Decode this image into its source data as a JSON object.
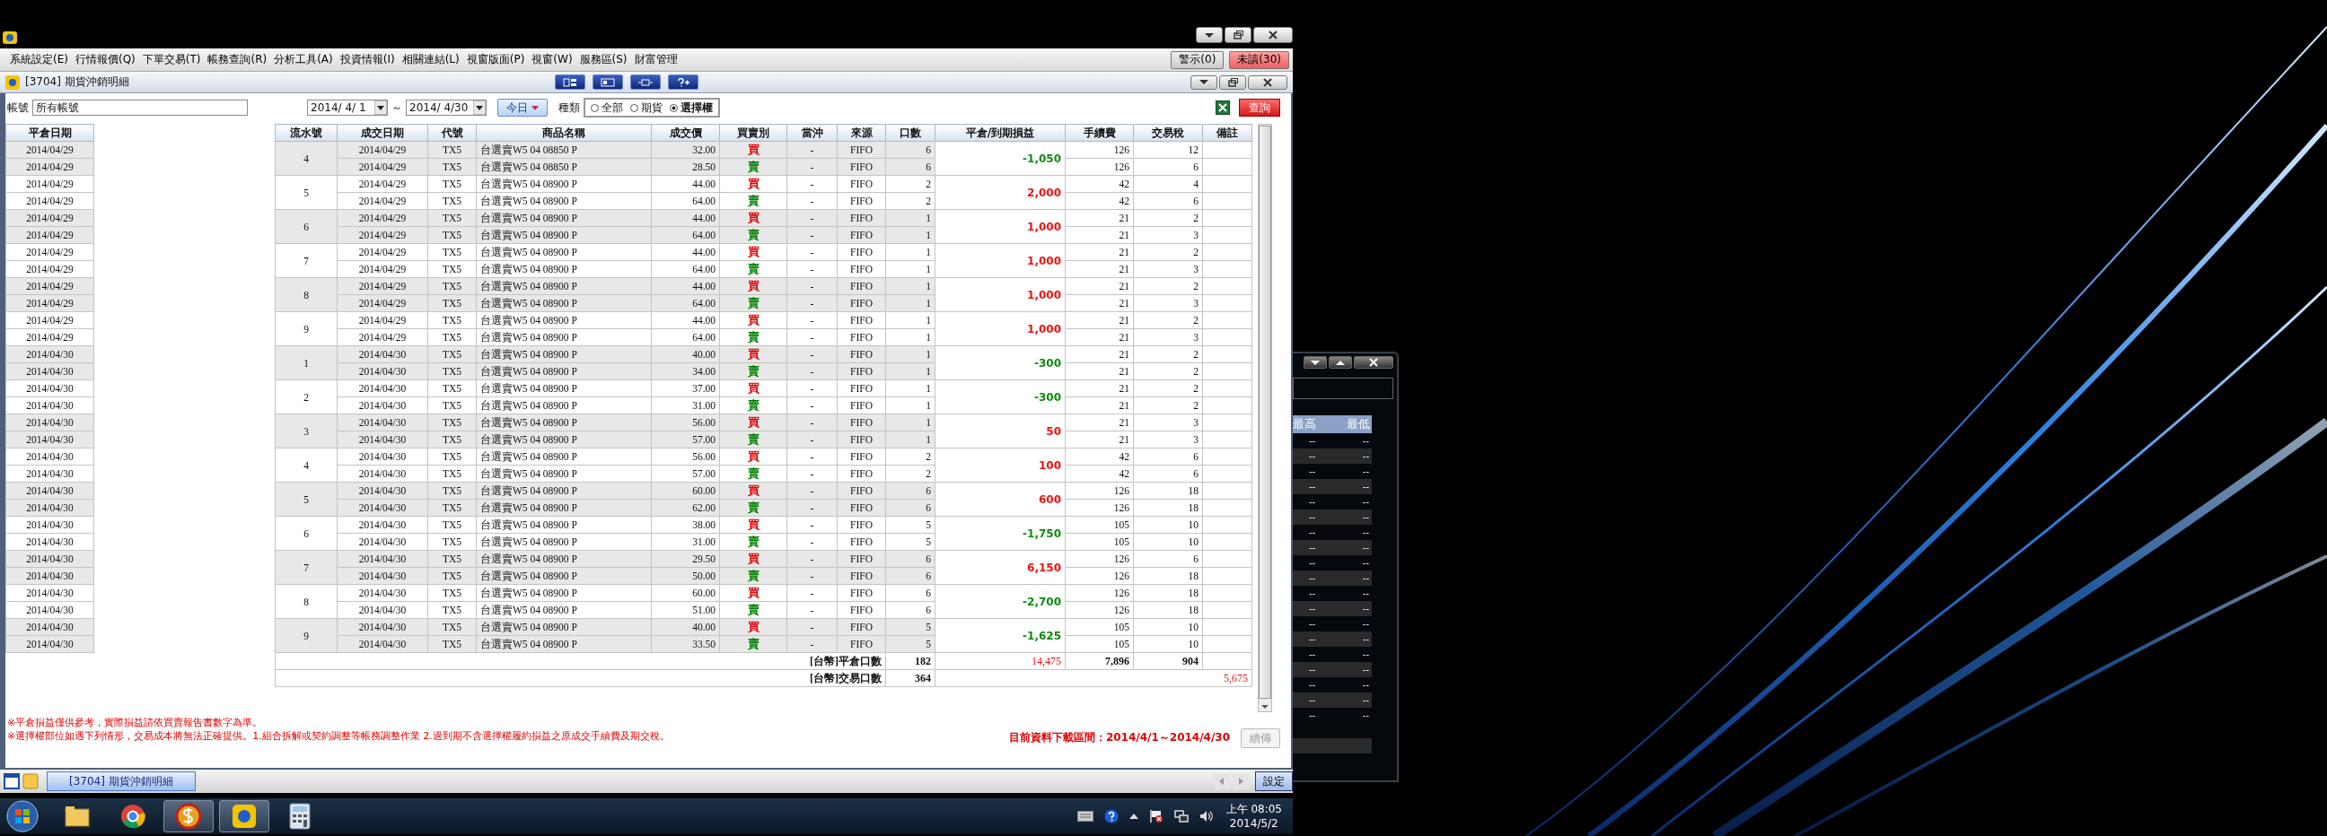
{
  "menu_bar": {
    "items": [
      "系統設定(E)",
      "行情報價(Q)",
      "下單交易(T)",
      "帳務查詢(R)",
      "分析工具(A)",
      "投資情報(I)",
      "相關連結(L)",
      "視窗版面(P)",
      "視窗(W)",
      "服務區(S)",
      "財富管理"
    ],
    "alert_button": "警示(0)",
    "unread_button": "未讀(30)"
  },
  "window": {
    "title": "[3704] 期貨沖銷明細"
  },
  "filters": {
    "account_label": "帳號",
    "account": "所有帳號",
    "date_from": "2014/ 4/ 1",
    "separator": "～",
    "date_to": "2014/ 4/30",
    "today_button": "今日",
    "type_label": "種類",
    "types": [
      {
        "label": "全部",
        "selected": false
      },
      {
        "label": "期貨",
        "selected": false
      },
      {
        "label": "選擇權",
        "selected": true
      }
    ],
    "query_button": "查詢"
  },
  "close_date_table": {
    "column": "平倉日期",
    "rows": [
      "2014/04/29",
      "2014/04/29",
      "2014/04/29",
      "2014/04/29",
      "2014/04/29",
      "2014/04/29",
      "2014/04/29",
      "2014/04/29",
      "2014/04/29",
      "2014/04/29",
      "2014/04/29",
      "2014/04/29",
      "2014/04/30",
      "2014/04/30",
      "2014/04/30",
      "2014/04/30",
      "2014/04/30",
      "2014/04/30",
      "2014/04/30",
      "2014/04/30",
      "2014/04/30",
      "2014/04/30",
      "2014/04/30",
      "2014/04/30",
      "2014/04/30",
      "2014/04/30",
      "2014/04/30",
      "2014/04/30",
      "2014/04/30",
      "2014/04/30"
    ]
  },
  "detail_table": {
    "columns": [
      "流水號",
      "成交日期",
      "代號",
      "商品名稱",
      "成交價",
      "買賣別",
      "當沖",
      "來源",
      "口數",
      "平倉/到期損益",
      "手續費",
      "交易稅",
      "備註"
    ],
    "groups": [
      {
        "serial": "4",
        "pnl": "-1,050",
        "color": "#108a10",
        "legs": [
          {
            "date": "2014/04/29",
            "code": "TX5",
            "product": "台選賣W5 04 08850 P",
            "price": "32.00",
            "side": "買",
            "color": "#e00000",
            "daytrade": "-",
            "source": "FIFO",
            "qty": "6",
            "fee": "126",
            "tax": "12"
          },
          {
            "date": "2014/04/29",
            "code": "TX5",
            "product": "台選賣W5 04 08850 P",
            "price": "28.50",
            "side": "賣",
            "color": "#008000",
            "daytrade": "-",
            "source": "FIFO",
            "qty": "6",
            "fee": "126",
            "tax": "6"
          }
        ]
      },
      {
        "serial": "5",
        "pnl": "2,000",
        "color": "#f01010",
        "legs": [
          {
            "date": "2014/04/29",
            "code": "TX5",
            "product": "台選賣W5 04 08900 P",
            "price": "44.00",
            "side": "買",
            "color": "#e00000",
            "daytrade": "-",
            "source": "FIFO",
            "qty": "2",
            "fee": "42",
            "tax": "4"
          },
          {
            "date": "2014/04/29",
            "code": "TX5",
            "product": "台選賣W5 04 08900 P",
            "price": "64.00",
            "side": "賣",
            "color": "#008000",
            "daytrade": "-",
            "source": "FIFO",
            "qty": "2",
            "fee": "42",
            "tax": "6"
          }
        ]
      },
      {
        "serial": "6",
        "pnl": "1,000",
        "color": "#f01010",
        "legs": [
          {
            "date": "2014/04/29",
            "code": "TX5",
            "product": "台選賣W5 04 08900 P",
            "price": "44.00",
            "side": "買",
            "color": "#e00000",
            "daytrade": "-",
            "source": "FIFO",
            "qty": "1",
            "fee": "21",
            "tax": "2"
          },
          {
            "date": "2014/04/29",
            "code": "TX5",
            "product": "台選賣W5 04 08900 P",
            "price": "64.00",
            "side": "賣",
            "color": "#008000",
            "daytrade": "-",
            "source": "FIFO",
            "qty": "1",
            "fee": "21",
            "tax": "3"
          }
        ]
      },
      {
        "serial": "7",
        "pnl": "1,000",
        "color": "#f01010",
        "legs": [
          {
            "date": "2014/04/29",
            "code": "TX5",
            "product": "台選賣W5 04 08900 P",
            "price": "44.00",
            "side": "買",
            "color": "#e00000",
            "daytrade": "-",
            "source": "FIFO",
            "qty": "1",
            "fee": "21",
            "tax": "2"
          },
          {
            "date": "2014/04/29",
            "code": "TX5",
            "product": "台選賣W5 04 08900 P",
            "price": "64.00",
            "side": "賣",
            "color": "#008000",
            "daytrade": "-",
            "source": "FIFO",
            "qty": "1",
            "fee": "21",
            "tax": "3"
          }
        ]
      },
      {
        "serial": "8",
        "pnl": "1,000",
        "color": "#f01010",
        "legs": [
          {
            "date": "2014/04/29",
            "code": "TX5",
            "product": "台選賣W5 04 08900 P",
            "price": "44.00",
            "side": "買",
            "color": "#e00000",
            "daytrade": "-",
            "source": "FIFO",
            "qty": "1",
            "fee": "21",
            "tax": "2"
          },
          {
            "date": "2014/04/29",
            "code": "TX5",
            "product": "台選賣W5 04 08900 P",
            "price": "64.00",
            "side": "賣",
            "color": "#008000",
            "daytrade": "-",
            "source": "FIFO",
            "qty": "1",
            "fee": "21",
            "tax": "3"
          }
        ]
      },
      {
        "serial": "9",
        "pnl": "1,000",
        "color": "#f01010",
        "legs": [
          {
            "date": "2014/04/29",
            "code": "TX5",
            "product": "台選賣W5 04 08900 P",
            "price": "44.00",
            "side": "買",
            "color": "#e00000",
            "daytrade": "-",
            "source": "FIFO",
            "qty": "1",
            "fee": "21",
            "tax": "2"
          },
          {
            "date": "2014/04/29",
            "code": "TX5",
            "product": "台選賣W5 04 08900 P",
            "price": "64.00",
            "side": "賣",
            "color": "#008000",
            "daytrade": "-",
            "source": "FIFO",
            "qty": "1",
            "fee": "21",
            "tax": "3"
          }
        ]
      },
      {
        "serial": "1",
        "pnl": "-300",
        "color": "#108a10",
        "legs": [
          {
            "date": "2014/04/30",
            "code": "TX5",
            "product": "台選賣W5 04 08900 P",
            "price": "40.00",
            "side": "買",
            "color": "#e00000",
            "daytrade": "-",
            "source": "FIFO",
            "qty": "1",
            "fee": "21",
            "tax": "2"
          },
          {
            "date": "2014/04/30",
            "code": "TX5",
            "product": "台選賣W5 04 08900 P",
            "price": "34.00",
            "side": "賣",
            "color": "#008000",
            "daytrade": "-",
            "source": "FIFO",
            "qty": "1",
            "fee": "21",
            "tax": "2"
          }
        ]
      },
      {
        "serial": "2",
        "pnl": "-300",
        "color": "#108a10",
        "legs": [
          {
            "date": "2014/04/30",
            "code": "TX5",
            "product": "台選賣W5 04 08900 P",
            "price": "37.00",
            "side": "買",
            "color": "#e00000",
            "daytrade": "-",
            "source": "FIFO",
            "qty": "1",
            "fee": "21",
            "tax": "2"
          },
          {
            "date": "2014/04/30",
            "code": "TX5",
            "product": "台選賣W5 04 08900 P",
            "price": "31.00",
            "side": "賣",
            "color": "#008000",
            "daytrade": "-",
            "source": "FIFO",
            "qty": "1",
            "fee": "21",
            "tax": "2"
          }
        ]
      },
      {
        "serial": "3",
        "pnl": "50",
        "color": "#f01010",
        "legs": [
          {
            "date": "2014/04/30",
            "code": "TX5",
            "product": "台選賣W5 04 08900 P",
            "price": "56.00",
            "side": "買",
            "color": "#e00000",
            "daytrade": "-",
            "source": "FIFO",
            "qty": "1",
            "fee": "21",
            "tax": "3"
          },
          {
            "date": "2014/04/30",
            "code": "TX5",
            "product": "台選賣W5 04 08900 P",
            "price": "57.00",
            "side": "賣",
            "color": "#008000",
            "daytrade": "-",
            "source": "FIFO",
            "qty": "1",
            "fee": "21",
            "tax": "3"
          }
        ]
      },
      {
        "serial": "4",
        "pnl": "100",
        "color": "#f01010",
        "legs": [
          {
            "date": "2014/04/30",
            "code": "TX5",
            "product": "台選賣W5 04 08900 P",
            "price": "56.00",
            "side": "買",
            "color": "#e00000",
            "daytrade": "-",
            "source": "FIFO",
            "qty": "2",
            "fee": "42",
            "tax": "6"
          },
          {
            "date": "2014/04/30",
            "code": "TX5",
            "product": "台選賣W5 04 08900 P",
            "price": "57.00",
            "side": "賣",
            "color": "#008000",
            "daytrade": "-",
            "source": "FIFO",
            "qty": "2",
            "fee": "42",
            "tax": "6"
          }
        ]
      },
      {
        "serial": "5",
        "pnl": "600",
        "color": "#f01010",
        "legs": [
          {
            "date": "2014/04/30",
            "code": "TX5",
            "product": "台選賣W5 04 08900 P",
            "price": "60.00",
            "side": "買",
            "color": "#e00000",
            "daytrade": "-",
            "source": "FIFO",
            "qty": "6",
            "fee": "126",
            "tax": "18"
          },
          {
            "date": "2014/04/30",
            "code": "TX5",
            "product": "台選賣W5 04 08900 P",
            "price": "62.00",
            "side": "賣",
            "color": "#008000",
            "daytrade": "-",
            "source": "FIFO",
            "qty": "6",
            "fee": "126",
            "tax": "18"
          }
        ]
      },
      {
        "serial": "6",
        "pnl": "-1,750",
        "color": "#108a10",
        "legs": [
          {
            "date": "2014/04/30",
            "code": "TX5",
            "product": "台選賣W5 04 08900 P",
            "price": "38.00",
            "side": "買",
            "color": "#e00000",
            "daytrade": "-",
            "source": "FIFO",
            "qty": "5",
            "fee": "105",
            "tax": "10"
          },
          {
            "date": "2014/04/30",
            "code": "TX5",
            "product": "台選賣W5 04 08900 P",
            "price": "31.00",
            "side": "賣",
            "color": "#008000",
            "daytrade": "-",
            "source": "FIFO",
            "qty": "5",
            "fee": "105",
            "tax": "10"
          }
        ]
      },
      {
        "serial": "7",
        "pnl": "6,150",
        "color": "#f01010",
        "legs": [
          {
            "date": "2014/04/30",
            "code": "TX5",
            "product": "台選賣W5 04 08900 P",
            "price": "29.50",
            "side": "買",
            "color": "#e00000",
            "daytrade": "-",
            "source": "FIFO",
            "qty": "6",
            "fee": "126",
            "tax": "6"
          },
          {
            "date": "2014/04/30",
            "code": "TX5",
            "product": "台選賣W5 04 08900 P",
            "price": "50.00",
            "side": "賣",
            "color": "#008000",
            "daytrade": "-",
            "source": "FIFO",
            "qty": "6",
            "fee": "126",
            "tax": "18"
          }
        ]
      },
      {
        "serial": "8",
        "pnl": "-2,700",
        "color": "#108a10",
        "legs": [
          {
            "date": "2014/04/30",
            "code": "TX5",
            "product": "台選賣W5 04 08900 P",
            "price": "60.00",
            "side": "買",
            "color": "#e00000",
            "daytrade": "-",
            "source": "FIFO",
            "qty": "6",
            "fee": "126",
            "tax": "18"
          },
          {
            "date": "2014/04/30",
            "code": "TX5",
            "product": "台選賣W5 04 08900 P",
            "price": "51.00",
            "side": "賣",
            "color": "#008000",
            "daytrade": "-",
            "source": "FIFO",
            "qty": "6",
            "fee": "126",
            "tax": "18"
          }
        ]
      },
      {
        "serial": "9",
        "pnl": "-1,625",
        "color": "#108a10",
        "legs": [
          {
            "date": "2014/04/30",
            "code": "TX5",
            "product": "台選賣W5 04 08900 P",
            "price": "40.00",
            "side": "買",
            "color": "#e00000",
            "daytrade": "-",
            "source": "FIFO",
            "qty": "5",
            "fee": "105",
            "tax": "10"
          },
          {
            "date": "2014/04/30",
            "code": "TX5",
            "product": "台選賣W5 04 08900 P",
            "price": "33.50",
            "side": "賣",
            "color": "#008000",
            "daytrade": "-",
            "source": "FIFO",
            "qty": "5",
            "fee": "105",
            "tax": "10"
          }
        ]
      }
    ],
    "totals": {
      "closed": {
        "label": "[台幣]平倉口數",
        "qty": "182",
        "pnl": "14,475",
        "fee": "7,896",
        "tax": "904"
      },
      "traded": {
        "label": "[台幣]交易口數",
        "qty": "364",
        "net": "5,675"
      }
    }
  },
  "notes": [
    "※平倉損益僅供參考，實際損益請依買賣報告書數字為準。",
    "※選擇權部位如遇下列情形，交易成本將無法正確提供。1.組合拆解或契約調整等帳務調整作業 2.過到期不含選擇權履約損益之原成交手續費及期交稅。"
  ],
  "download_range": "目前資料下載區間：2014/4/1～2014/4/30",
  "resume_button": {
    "label": "續傳",
    "disabled": true
  },
  "bottom_tabs": {
    "tabs": [
      {
        "label": "[3704] 期貨沖銷明細",
        "selected": true
      }
    ],
    "settings_button": "設定"
  },
  "taskbar": {
    "clock_time": "上午 08:05",
    "clock_date": "2014/5/2"
  },
  "quote_window": {
    "columns": [
      "最高",
      "最低"
    ],
    "rows": [
      {
        "high": "--",
        "low": "--"
      },
      {
        "high": "--",
        "low": "--"
      },
      {
        "high": "--",
        "low": "--"
      },
      {
        "high": "--",
        "low": "--"
      },
      {
        "high": "--",
        "low": "--"
      },
      {
        "high": "--",
        "low": "--"
      },
      {
        "high": "--",
        "low": "--"
      },
      {
        "high": "--",
        "low": "--"
      },
      {
        "high": "--",
        "low": "--"
      },
      {
        "high": "--",
        "low": "--"
      },
      {
        "high": "--",
        "low": "--"
      },
      {
        "high": "--",
        "low": "--"
      },
      {
        "high": "--",
        "low": "--"
      },
      {
        "high": "--",
        "low": "--"
      },
      {
        "high": "--",
        "low": "--"
      },
      {
        "high": "--",
        "low": "--"
      },
      {
        "high": "--",
        "low": "--"
      },
      {
        "high": "--",
        "low": "--"
      },
      {
        "high": "--",
        "low": "--"
      }
    ]
  }
}
